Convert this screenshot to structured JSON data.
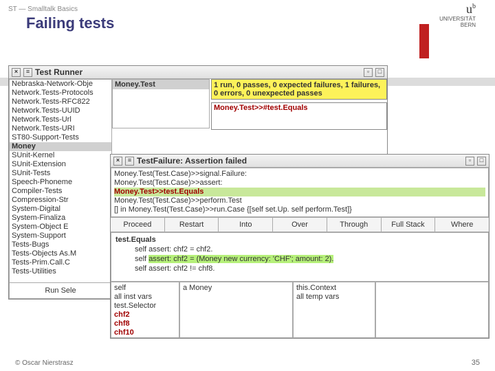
{
  "header": {
    "crumb": "ST — Smalltalk Basics",
    "title": "Failing tests"
  },
  "logo": {
    "b": "b",
    "u": "u",
    "line1": "UNIVERSITÄT",
    "line2": "BERN"
  },
  "testRunner": {
    "title": "Test Runner",
    "categories": [
      "Nebraska-Network-Obje",
      "Network.Tests-Protocols",
      "Network.Tests-RFC822",
      "Network.Tests-UUID",
      "Network.Tests-Url",
      "Network.Tests-URI",
      "ST80-Support-Tests",
      "Money",
      "SUnit-Kernel",
      "SUnit-Extension",
      "SUnit-Tests",
      "Speech-Phoneme",
      "Compiler-Tests",
      "Compression-Str",
      "System-Digital",
      "System-Finaliza",
      "System-Object E",
      "System-Support",
      "Tests-Bugs",
      "Tests-Objects As.M",
      "Tests-Prim.Call.C",
      "Tests-Utilities"
    ],
    "selectedCategory": "Money",
    "classes": [
      "Money.Test"
    ],
    "status": "1 run, 0 passes, 0 expected failures, 1 failures, 0 errors, 0 unexpected passes",
    "failures": [
      "Money.Test>>#test.Equals"
    ],
    "runSelected": "Run Sele"
  },
  "debugger": {
    "title": "TestFailure: Assertion failed",
    "stack": [
      "Money.Test(Test.Case)>>signal.Failure:",
      "Money.Test(Test.Case)>>assert:",
      "Money.Test>>test.Equals",
      "Money.Test(Test.Case)>>perform.Test",
      "[] in Money.Test(Test.Case)>>run.Case {[self set.Up.  self perform.Test]}"
    ],
    "stackSelIndex": 2,
    "buttons": [
      "Proceed",
      "Restart",
      "Into",
      "Over",
      "Through",
      "Full Stack",
      "Where"
    ],
    "code": {
      "method": "test.Equals",
      "l1": "self assert: chf2 = chf2.",
      "l2a": "self ",
      "l2b": "assert: chf2 = (Money new currency: 'CHF'; amount: 2).",
      "l3": "self assert: chf2 != chf8."
    },
    "inspectLeft": [
      "self",
      "all inst vars",
      "test.Selector"
    ],
    "inspectLeftRed": [
      "chf2",
      "chf8",
      "chf10"
    ],
    "inspectMid": "a Money",
    "inspectRight": [
      "this.Context",
      "all temp vars"
    ]
  },
  "footer": {
    "left": "© Oscar Nierstrasz",
    "right": "35"
  }
}
